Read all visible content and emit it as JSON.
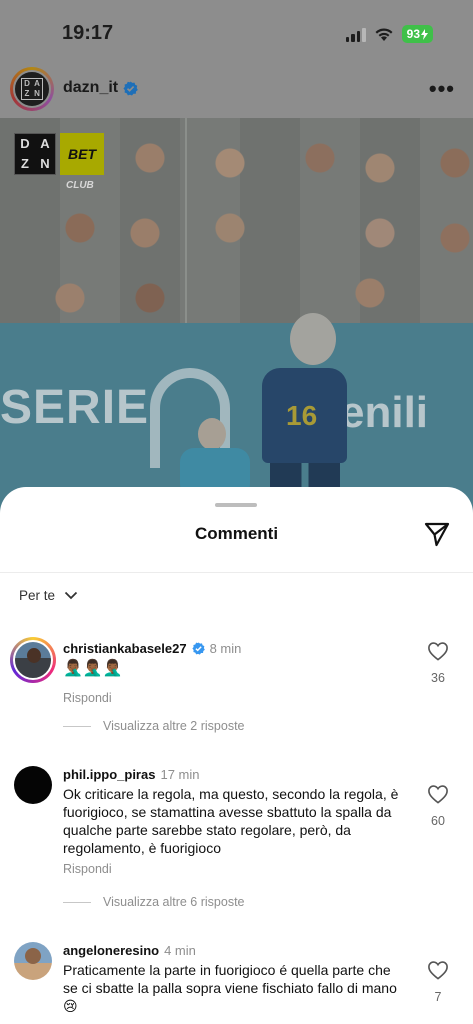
{
  "status_bar": {
    "time": "19:17",
    "battery": "93"
  },
  "post": {
    "username": "dazn_it",
    "more": "•••"
  },
  "media": {
    "logo_dazn": [
      "D",
      "A",
      "Z",
      "N"
    ],
    "logo_bet": "BET",
    "logo_club": "CLUB",
    "board_left": "SERIE",
    "board_right": "enili",
    "player_number": "16"
  },
  "sheet": {
    "title": "Commenti",
    "sort_label": "Per te"
  },
  "comments": [
    {
      "username": "christiankabasele27",
      "verified": true,
      "time": "8 min",
      "text": "🤦🏾‍♂️🤦🏾‍♂️🤦🏾‍♂️",
      "reply": "Rispondi",
      "likes": "36",
      "more_replies": "Visualizza altre 2 risposte"
    },
    {
      "username": "phil.ippo_piras",
      "verified": false,
      "time": "17 min",
      "text": "Ok criticare la regola, ma questo, secondo la regola, è fuorigioco, se stamattina avesse sbattuto la spalla da qualche parte sarebbe stato regolare, però, da regolamento, è fuorigioco",
      "reply": "Rispondi",
      "likes": "60",
      "more_replies": "Visualizza altre 6 risposte"
    },
    {
      "username": "angeloneresino",
      "verified": false,
      "time": "4 min",
      "text": "Praticamente la parte in fuorigioco é quella parte che se ci sbatte la palla sopra viene fischiato fallo di mano 😢",
      "likes": "7"
    }
  ],
  "colors": {
    "verified": "#3797f0",
    "battery": "#3fc049",
    "secondary_text": "#8e8e8e"
  }
}
